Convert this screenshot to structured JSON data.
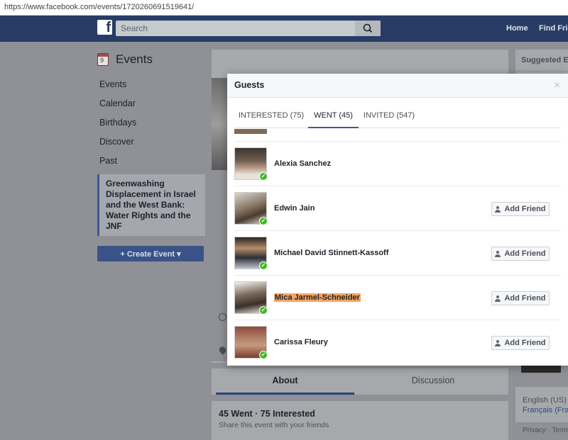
{
  "browser": {
    "url": "https://www.facebook.com/events/1720260691519641/"
  },
  "topbar": {
    "logo": "f",
    "search_placeholder": "Search",
    "nav": [
      "Home",
      "Find Frie"
    ]
  },
  "sidebar": {
    "title": "Events",
    "calendar_day": "9",
    "items": [
      "Events",
      "Calendar",
      "Birthdays",
      "Discover",
      "Past"
    ],
    "current_event": "Greenwashing Displacement in Israel and the West Bank: Water Rights and the JNF",
    "create_label": "+ Create Event ▾"
  },
  "main": {
    "tabs": [
      "About",
      "Discussion"
    ],
    "stats_title": "45 Went · 75 Interested",
    "stats_sub": "Share this event with your friends"
  },
  "right": {
    "header": "Suggested Ev",
    "lang_current": "English (US)",
    "lang_alt": "Français (Fran",
    "footer": "Privacy · Term"
  },
  "modal": {
    "title": "Guests",
    "close": "×",
    "tabs": [
      "INTERESTED (75)",
      "WENT (45)",
      "INVITED (547)"
    ],
    "active_tab": 1,
    "add_friend_label": "Add Friend",
    "guests": [
      {
        "name": "Alexia Sanchez",
        "has_button": false,
        "highlighted": false
      },
      {
        "name": "Edwin Jain",
        "has_button": true,
        "highlighted": false
      },
      {
        "name": "Michael David Stinnett-Kassoff",
        "has_button": true,
        "highlighted": false
      },
      {
        "name": "Mica Jarmel-Schneider",
        "has_button": true,
        "highlighted": true
      },
      {
        "name": "Carissa Fleury",
        "has_button": true,
        "highlighted": false
      }
    ]
  }
}
